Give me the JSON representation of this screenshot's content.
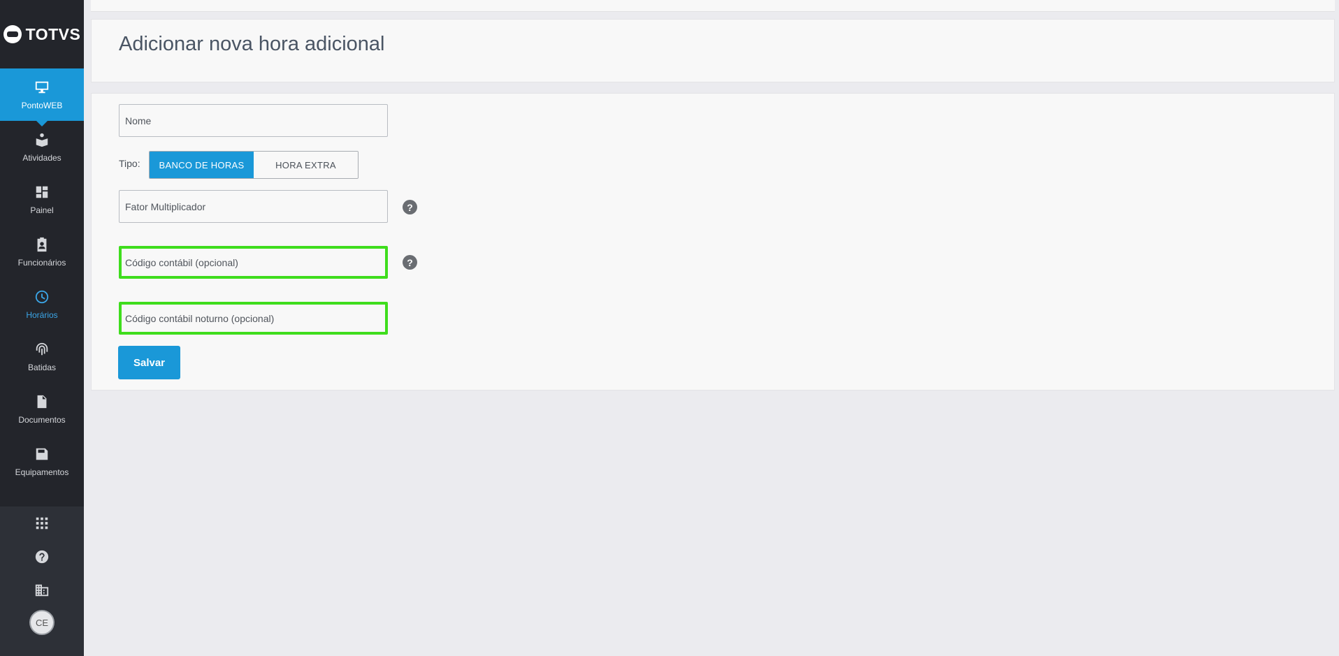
{
  "brand": {
    "logo_text": "TOTVS"
  },
  "sidebar": {
    "items": [
      {
        "label": "PontoWEB",
        "icon": "monitor-icon"
      },
      {
        "label": "Atividades",
        "icon": "activities-icon"
      },
      {
        "label": "Painel",
        "icon": "dashboard-icon"
      },
      {
        "label": "Funcionários",
        "icon": "badge-icon"
      },
      {
        "label": "Horários",
        "icon": "clock-icon"
      },
      {
        "label": "Batidas",
        "icon": "fingerprint-icon"
      },
      {
        "label": "Documentos",
        "icon": "document-icon"
      },
      {
        "label": "Equipamentos",
        "icon": "device-icon"
      }
    ],
    "bottom": {
      "apps_icon": "apps-grid-icon",
      "help_icon": "help-icon",
      "company_icon": "building-icon",
      "avatar_initials": "CE"
    }
  },
  "header": {
    "title": "Adicionar nova hora adicional"
  },
  "form": {
    "nome_placeholder": "Nome",
    "tipo_label": "Tipo:",
    "tipo_options": [
      "BANCO DE HORAS",
      "HORA EXTRA"
    ],
    "tipo_selected": "BANCO DE HORAS",
    "fator_placeholder": "Fator Multiplicador",
    "codigo_placeholder": "Código contábil (opcional)",
    "codigo_noturno_placeholder": "Código contábil noturno (opcional)",
    "help_glyph": "?",
    "save_label": "Salvar"
  },
  "colors": {
    "accent": "#1a98d8",
    "sidebar_bg": "#23252b",
    "highlight": "#3fdd1d",
    "active_nav_text": "#3ba6e8"
  }
}
